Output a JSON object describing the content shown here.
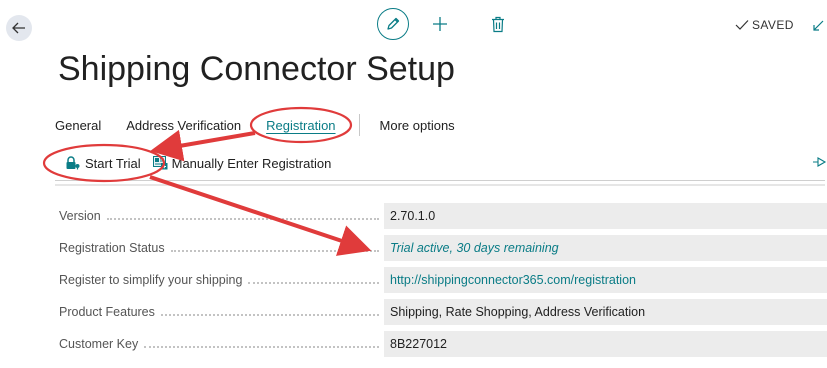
{
  "header": {
    "saved_label": "SAVED",
    "title": "Shipping Connector Setup"
  },
  "tabs": [
    {
      "label": "General"
    },
    {
      "label": "Address Verification"
    },
    {
      "label": "Registration",
      "active": true
    },
    {
      "label": "More options"
    }
  ],
  "actions": {
    "start_trial": "Start Trial",
    "manual_registration": "Manually Enter Registration"
  },
  "fields": [
    {
      "label": "Version",
      "value": "2.70.1.0"
    },
    {
      "label": "Registration Status",
      "value": "Trial active, 30 days remaining"
    },
    {
      "label": "Register to simplify your shipping",
      "value": "http://shippingconnector365.com/registration"
    },
    {
      "label": "Product Features",
      "value": "Shipping, Rate Shopping, Address Verification"
    },
    {
      "label": "Customer Key",
      "value": "8B227012"
    }
  ],
  "colors": {
    "accent": "#0a7c86",
    "annotation": "#e03b3b",
    "field_background": "#ececec"
  },
  "icons": {
    "back": "arrow-left-icon",
    "edit": "pencil-icon",
    "add": "plus-icon",
    "delete": "trash-icon",
    "saved": "checkmark-icon",
    "expand": "expand-icon",
    "start_trial": "lock-key-icon",
    "manual_registration": "registration-card-icon",
    "pin": "pin-icon"
  }
}
